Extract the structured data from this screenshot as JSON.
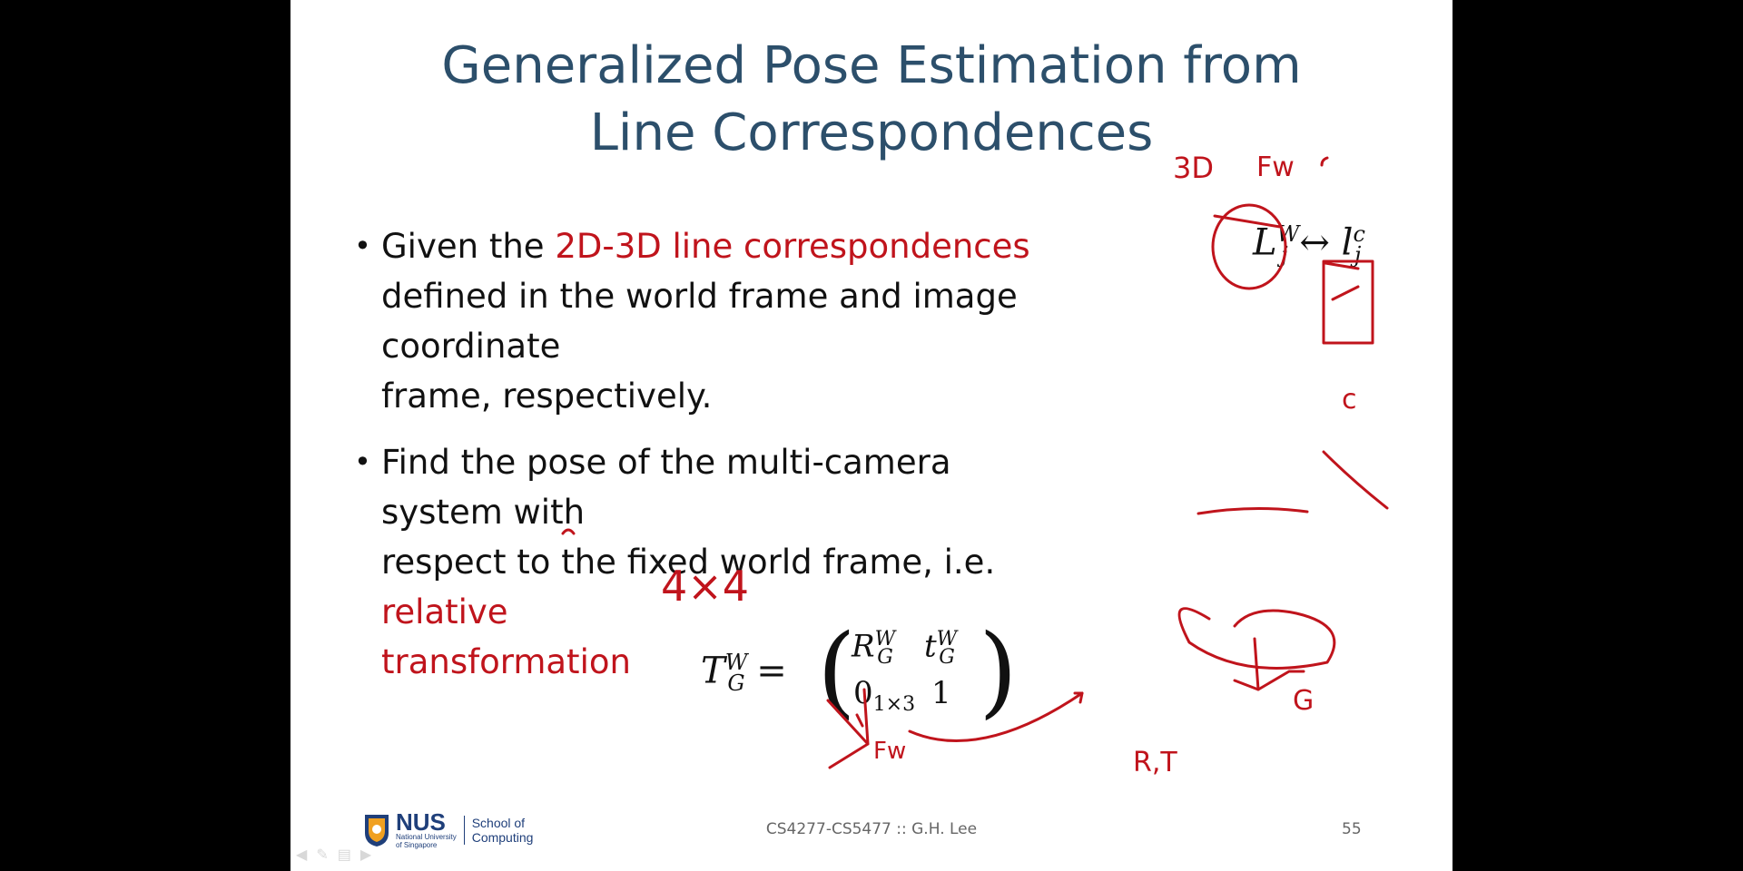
{
  "slide": {
    "title_line1": "Generalized Pose Estimation from",
    "title_line2": "Line Correspondences",
    "bullet1": {
      "prefix": "Given the ",
      "highlight": "2D-3D line correspondences",
      "line2": "defined in the world frame and image coordinate",
      "line3": "frame, respectively."
    },
    "bullet2": {
      "line1": "Find the pose of the multi-camera system with",
      "line2_prefix": "respect to the fixed world frame, i.e. ",
      "line2_highlight": "relative",
      "line3_highlight": "transformation"
    },
    "footer": {
      "course": "CS4277-CS5477 :: G.H. Lee",
      "page": "55",
      "logo_text": "NUS",
      "logo_sub1": "National University",
      "logo_sub2": "of Singapore",
      "school_line1": "School of",
      "school_line2": "Computing"
    }
  },
  "annotations": {
    "matrix_size": "4×4",
    "label_3d": "3D",
    "label_fw": "Fw",
    "label_c": "c",
    "label_g": "G",
    "label_rt": "R,T",
    "label_fw2": "Fw"
  },
  "colors": {
    "title": "#2c4f6b",
    "highlight": "#c0141c",
    "ink": "#c0141c",
    "nus_blue": "#1f3f7a"
  }
}
